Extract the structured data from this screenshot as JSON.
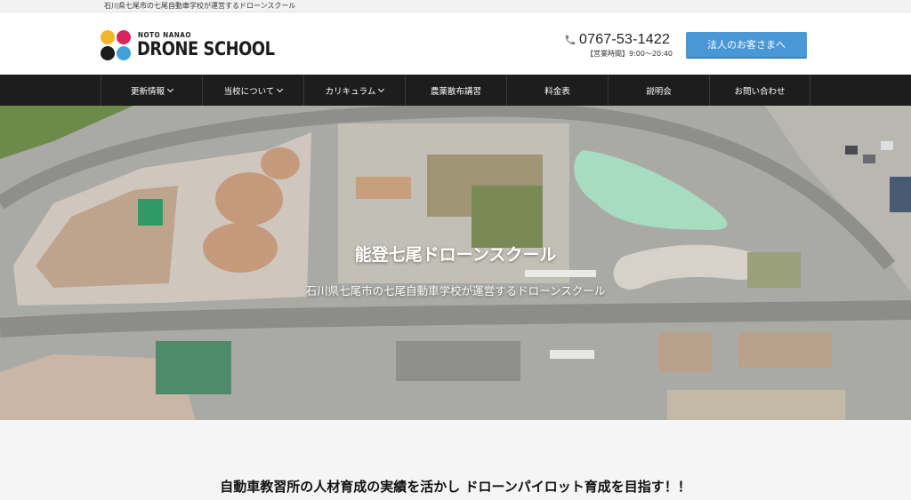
{
  "topbar": {
    "text": "石川県七尾市の七尾自動車学校が運営するドローンスクール"
  },
  "logo": {
    "small_text": "NOTO NANAO",
    "big_text": "DRONE SCHOOL",
    "dot_colors": [
      "#f2b62c",
      "#d8245f",
      "#1b1b1b",
      "#3ea2d8"
    ]
  },
  "contact": {
    "phone": "0767-53-1422",
    "hours": "【営業時間】9:00〜20:40",
    "corporate_button": "法人のお客さまへ"
  },
  "nav": {
    "items": [
      {
        "label": "更新情報",
        "dropdown": true
      },
      {
        "label": "当校について",
        "dropdown": true
      },
      {
        "label": "カリキュラム",
        "dropdown": true
      },
      {
        "label": "農薬散布講習",
        "dropdown": false
      },
      {
        "label": "料金表",
        "dropdown": false
      },
      {
        "label": "説明会",
        "dropdown": false
      },
      {
        "label": "お問い合わせ",
        "dropdown": false
      }
    ]
  },
  "hero": {
    "title": "能登七尾ドローンスクール",
    "subtitle": "石川県七尾市の七尾自動車学校が運営するドローンスクール"
  },
  "section": {
    "title": "自動車教習所の人材育成の実績を活かし ドローンパイロット育成を目指す！！"
  }
}
